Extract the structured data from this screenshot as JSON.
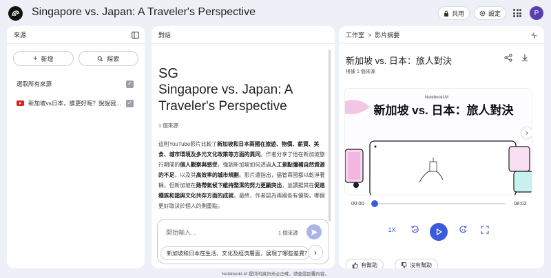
{
  "header": {
    "title": "Singapore vs. Japan: A Traveler's Perspective",
    "share_label": "共用",
    "settings_label": "設定",
    "avatar_letter": "P"
  },
  "sources": {
    "title": "來源",
    "add_label": "新增",
    "explore_label": "探索",
    "select_all_label": "選取所有來源",
    "items": [
      {
        "label": "新加坡vs日本，誰更好呢？說說我..."
      }
    ]
  },
  "chat": {
    "title": "對話",
    "note_emoji": "SG",
    "note_title": "Singapore vs. Japan: A Traveler's Perspective",
    "source_count": "1 個來源",
    "summary_parts": [
      {
        "t": "這則YouTube影片比較了",
        "b": false
      },
      {
        "t": "新加坡和日本兩國在旅遊、物價、薪資、美食、城市環境及多元文化政策等方面的異同",
        "b": true
      },
      {
        "t": "。作者分享了他在新加坡旅行期間的",
        "b": false
      },
      {
        "t": "個人觀察與感受",
        "b": true
      },
      {
        "t": "，強調新加坡如何透過",
        "b": false
      },
      {
        "t": "人工景點彌補自然資源的不足",
        "b": true
      },
      {
        "t": "，以及其",
        "b": false
      },
      {
        "t": "高效率的城市規劃",
        "b": true
      },
      {
        "t": "。影片還指出，儘管兩國都以乾淨著稱，但新加坡在",
        "b": false
      },
      {
        "t": "熱帶氣候下維持整潔的努力更顯突出",
        "b": true
      },
      {
        "t": "，並讚揚其在",
        "b": false
      },
      {
        "t": "促進種族和諧與文化共存方面的成就",
        "b": true
      },
      {
        "t": "。最終，作者認為兩國各有優勢，哪個更好取決於個人的側重點。",
        "b": false
      }
    ],
    "input_placeholder": "開始輸入...",
    "input_source_count": "1 個來源",
    "suggestion": "新加坡和日本在生活、文化及經濟層面，展現了哪些差異？"
  },
  "studio": {
    "breadcrumb_root": "工作室",
    "breadcrumb_sep": ">",
    "breadcrumb_page": "影片摘要",
    "video_title": "新加坡 vs. 日本：旅人對決",
    "based_on": "根據 1 個來源",
    "thumb_brand": "NotebookLM",
    "thumb_text": "新加坡 vs. 日本：旅人對決",
    "time_current": "00:00",
    "time_total": "08:02",
    "progress_fraction": 0.0,
    "speed_label": "1X",
    "helpful_label": "有幫助",
    "not_helpful_label": "沒有幫助"
  },
  "footer": {
    "disclaimer": "NotebookLM 提供的資訊未必正確，請查證回覆內容。"
  },
  "colors": {
    "accent": "#3b5bdb",
    "background": "#eef0f8",
    "youtube": "#e02020"
  }
}
